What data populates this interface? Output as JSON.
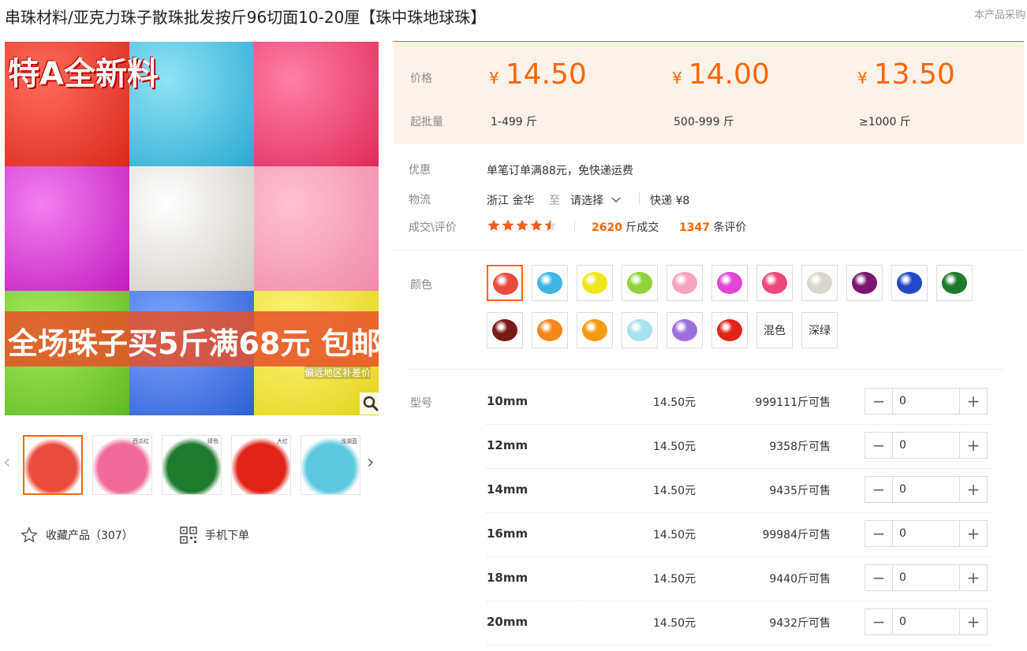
{
  "product": {
    "title": "串珠材料/亚克力珠子散珠批发按斤96切面10-20厘【珠中珠地球珠】",
    "notice": "本产品采购"
  },
  "gallery": {
    "promo_top": "特A全新料",
    "promo_text": "全场珠子买5斤满68元 包邮",
    "promo_sub": "偏远地区补差价",
    "zoom_icon": "magnifier-icon",
    "thumbnails": [
      {
        "label": "",
        "color": "#e94c3d",
        "active": true
      },
      {
        "label": "西瓜红",
        "color": "#f06a9a",
        "active": false
      },
      {
        "label": "绿色",
        "color": "#1e7a2c",
        "active": false
      },
      {
        "label": "大红",
        "color": "#e02418",
        "active": false
      },
      {
        "label": "浅湖蓝",
        "color": "#5cc9e0",
        "active": false
      }
    ]
  },
  "actions": {
    "favorite_label": "收藏产品（307）",
    "favorite_icon": "star-icon",
    "mobile_label": "手机下单",
    "mobile_icon": "qr-code-icon"
  },
  "pricing": {
    "price_label": "价格",
    "qty_label": "起批量",
    "currency": "¥",
    "tiers": [
      {
        "price": "14.50",
        "range": "1-499 斤"
      },
      {
        "price": "14.00",
        "range": "500-999 斤"
      },
      {
        "price": "13.50",
        "range": "≥1000 斤"
      }
    ]
  },
  "info": {
    "promo_label": "优惠",
    "promo_text": "单笔订单满88元，免快递运费",
    "logistics_label": "物流",
    "origin": "浙江 金华",
    "to": "至",
    "destination": "请选择",
    "shipping": "快递 ¥8",
    "deal_label": "成交\\评价",
    "rating": 4.5,
    "sold_count": "2620",
    "sold_unit": "斤成交",
    "review_count": "1347",
    "review_unit": "条评价"
  },
  "colors": {
    "label": "颜色",
    "swatches": [
      {
        "kind": "image",
        "color": "#e94c3d",
        "active": true
      },
      {
        "kind": "image",
        "color": "#3fb6e3"
      },
      {
        "kind": "image",
        "color": "#f0e61a"
      },
      {
        "kind": "image",
        "color": "#8fd43a"
      },
      {
        "kind": "image",
        "color": "#f5a3bf"
      },
      {
        "kind": "image",
        "color": "#e346d4"
      },
      {
        "kind": "image",
        "color": "#f2477d"
      },
      {
        "kind": "image",
        "color": "#d9d6cf"
      },
      {
        "kind": "image",
        "color": "#7a1670"
      },
      {
        "kind": "image",
        "color": "#2447c7"
      },
      {
        "kind": "image",
        "color": "#1e7a2c"
      },
      {
        "kind": "image",
        "color": "#7a1a16"
      },
      {
        "kind": "image",
        "color": "#f5861a"
      },
      {
        "kind": "image",
        "color": "#f59b12"
      },
      {
        "kind": "image",
        "color": "#a8e1ef"
      },
      {
        "kind": "image",
        "color": "#9b6fe0"
      },
      {
        "kind": "image",
        "color": "#e02418"
      },
      {
        "kind": "text",
        "text": "混色"
      },
      {
        "kind": "text",
        "text": "深绿"
      }
    ]
  },
  "variants": {
    "label": "型号",
    "price_suffix": "元",
    "stock_suffix": "斤可售",
    "rows": [
      {
        "name": "10mm",
        "price": "14.50",
        "stock": "999111",
        "qty": "0"
      },
      {
        "name": "12mm",
        "price": "14.50",
        "stock": "9358",
        "qty": "0"
      },
      {
        "name": "14mm",
        "price": "14.50",
        "stock": "9435",
        "qty": "0"
      },
      {
        "name": "16mm",
        "price": "14.50",
        "stock": "99984",
        "qty": "0"
      },
      {
        "name": "18mm",
        "price": "14.50",
        "stock": "9440",
        "qty": "0"
      },
      {
        "name": "20mm",
        "price": "14.50",
        "stock": "9432",
        "qty": "0"
      }
    ]
  },
  "theme": {
    "accent": "#ff6600",
    "price_bg": "#fdf2e9"
  }
}
